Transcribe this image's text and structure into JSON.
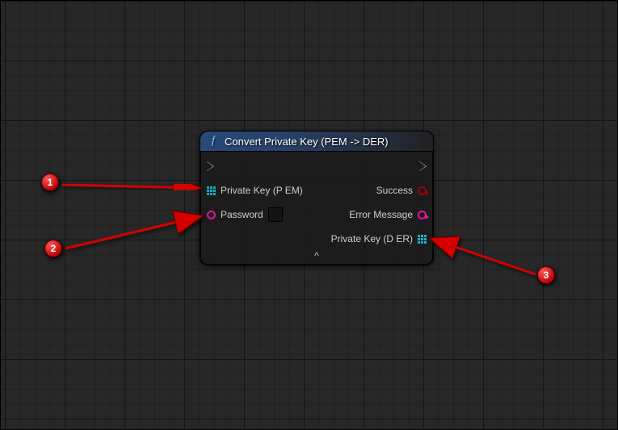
{
  "node": {
    "title": "Convert Private Key (PEM -> DER)",
    "function_icon": "f",
    "inputs": {
      "exec_in": "",
      "private_key_pem": {
        "label": "Private Key (P EM)",
        "pin_type": "struct"
      },
      "password": {
        "label": "Password",
        "pin_type": "string",
        "value": ""
      }
    },
    "outputs": {
      "exec_out": "",
      "success": {
        "label": "Success",
        "pin_type": "bool"
      },
      "error_message": {
        "label": "Error Message",
        "pin_type": "string"
      },
      "private_key_der": {
        "label": "Private Key (D ER)",
        "pin_type": "struct"
      }
    },
    "expand_icon": "^"
  },
  "annotations": {
    "a1": "1",
    "a2": "2",
    "a3": "3"
  },
  "colors": {
    "struct_pin": "#12a9c4",
    "string_pin": "#e0169c",
    "bool_pin": "#a30000",
    "header_gradient_start": "#274a7a"
  }
}
